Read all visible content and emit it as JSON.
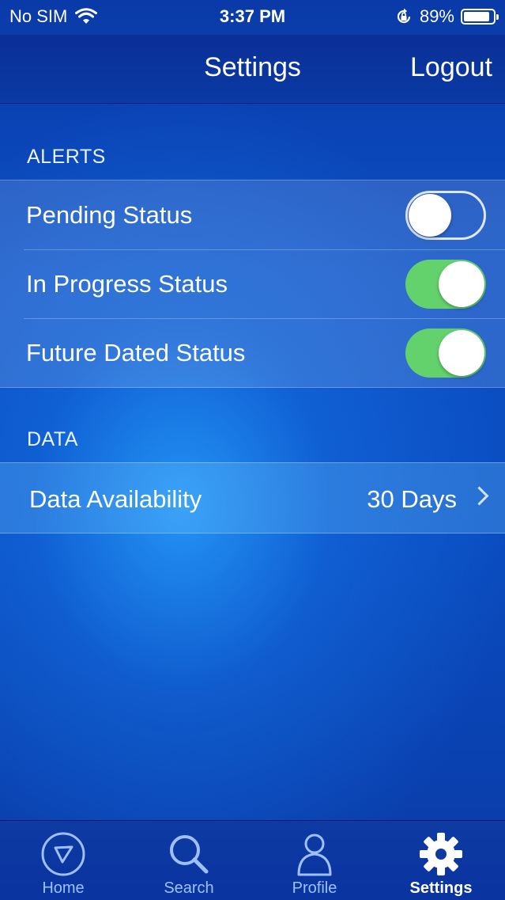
{
  "status_bar": {
    "carrier": "No SIM",
    "time": "3:37 PM",
    "battery_percent": "89%",
    "battery_level": 0.89
  },
  "nav": {
    "title": "Settings",
    "logout_label": "Logout"
  },
  "alerts": {
    "header": "ALERTS",
    "items": [
      {
        "label": "Pending Status",
        "enabled": false
      },
      {
        "label": "In Progress Status",
        "enabled": true
      },
      {
        "label": "Future Dated Status",
        "enabled": true
      }
    ]
  },
  "data_section": {
    "header": "DATA",
    "row_label": "Data Availability",
    "row_value": "30 Days"
  },
  "tabs": [
    {
      "label": "Home",
      "icon": "navigation-arrow-icon",
      "active": false
    },
    {
      "label": "Search",
      "icon": "magnifier-icon",
      "active": false
    },
    {
      "label": "Profile",
      "icon": "person-icon",
      "active": false
    },
    {
      "label": "Settings",
      "icon": "gear-icon",
      "active": true
    }
  ],
  "colors": {
    "toggle_on": "#64d26c",
    "tab_inactive": "#9fc0ff",
    "tab_active": "#ffffff"
  }
}
